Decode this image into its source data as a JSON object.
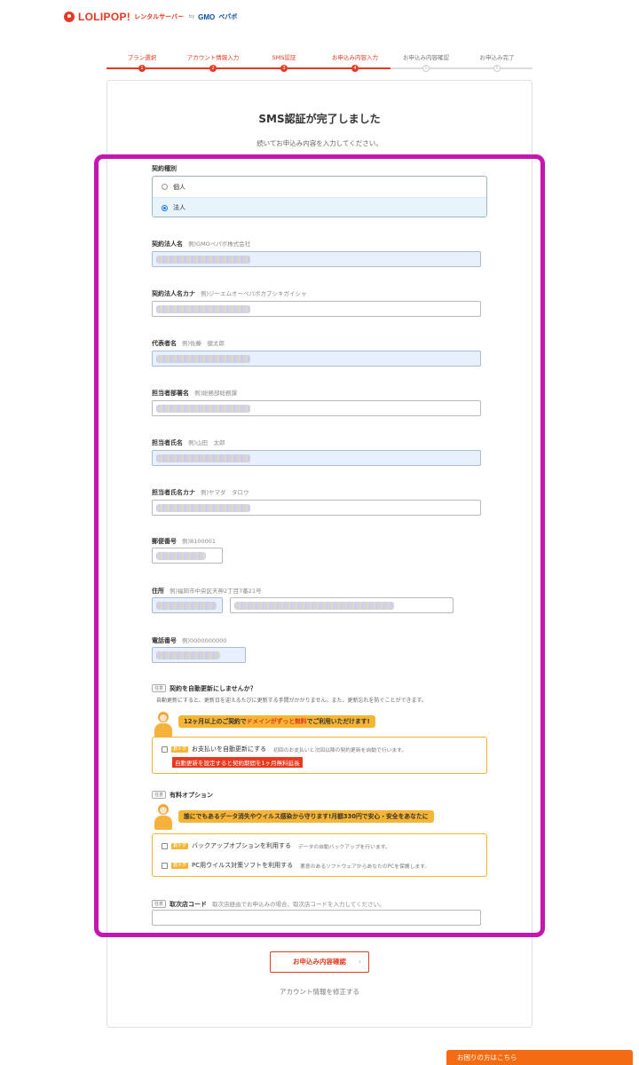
{
  "brand": {
    "name": "LOLIPOP!",
    "sub": "レンタルサーバー",
    "by": "by",
    "gmo": "GMO",
    "pepabo": "ペパボ"
  },
  "steps": [
    {
      "label": "プラン選択",
      "num": "1",
      "state": "done"
    },
    {
      "label": "アカウント情報入力",
      "num": "2",
      "state": "done"
    },
    {
      "label": "SMS認証",
      "num": "3",
      "state": "done"
    },
    {
      "label": "お申込み内容入力",
      "num": "4",
      "state": "done"
    },
    {
      "label": "お申込み内容確認",
      "num": "5",
      "state": "todo"
    },
    {
      "label": "お申込み完了",
      "num": "6",
      "state": "todo"
    }
  ],
  "page": {
    "title": "SMS認証が完了しました",
    "subtitle": "続いてお申込み内容を入力してください。"
  },
  "contract_type": {
    "label": "契約種別",
    "options": [
      "個人",
      "法人"
    ],
    "selected": "法人"
  },
  "fields": {
    "corp_name": {
      "label": "契約法人名",
      "example": "例)GMOペパボ株式会社"
    },
    "corp_kana": {
      "label": "契約法人名カナ",
      "example": "例)ジーエムオーペパボカブシキガイシャ"
    },
    "representative": {
      "label": "代表者名",
      "example": "例)佐藤　健太郎"
    },
    "department": {
      "label": "担当者部署名",
      "example": "例)総務部総務課"
    },
    "person_name": {
      "label": "担当者氏名",
      "example": "例)山田　太郎"
    },
    "person_kana": {
      "label": "担当者氏名カナ",
      "example": "例)ヤマダ　タロウ"
    },
    "postal": {
      "label": "郵便番号",
      "example": "例)8100001"
    },
    "address": {
      "label": "住所",
      "example": "例)福岡市中央区天神2丁目7番21号"
    },
    "phone": {
      "label": "電話番号",
      "example": "例)0000000000"
    }
  },
  "auto_renew": {
    "tag": "任意",
    "label": "契約を自動更新にしませんか？",
    "desc": "自動更新にすると、更新日を迎えるたびに更新する手間がかかりません。また、更新忘れを防ぐことができます。",
    "bubble_pre": "12ヶ月以上のご契約で",
    "bubble_red": "ドメインがずっと無料",
    "bubble_post": "でご利用いただけます!",
    "badge": "おトク",
    "option_label": "お支払いを自動更新にする",
    "option_desc": "初回のお支払いと次回以降の契約更新を自動で行います。",
    "note": "自動更新を設定すると契約期間を1ヶ月無料延長"
  },
  "paid_options": {
    "tag": "任意",
    "label": "有料オプション",
    "bubble": "誰にでもあるデータ消失やウイルス感染から守ります!月額330円で安心・安全をあなたに",
    "badge": "おトク",
    "items": [
      {
        "label": "バックアップオプションを利用する",
        "desc": "データの自動バックアップを行います。"
      },
      {
        "label": "PC用ウイルス対策ソフトを利用する",
        "desc": "悪意のあるソフトウェアからあなたのPCを保護します。"
      }
    ]
  },
  "agency": {
    "tag": "任意",
    "label": "取次店コード",
    "desc": "取次店経由でお申込みの場合、取次店コードを入力してください。"
  },
  "actions": {
    "submit": "お申込み内容確認",
    "submit_arrow": "›",
    "edit": "アカウント情報を修正する",
    "help": "お困りの方はこちら"
  },
  "colors": {
    "accent": "#e8381f",
    "highlight": "#c317b0",
    "promo": "#f6b535",
    "help": "#f46c11"
  }
}
